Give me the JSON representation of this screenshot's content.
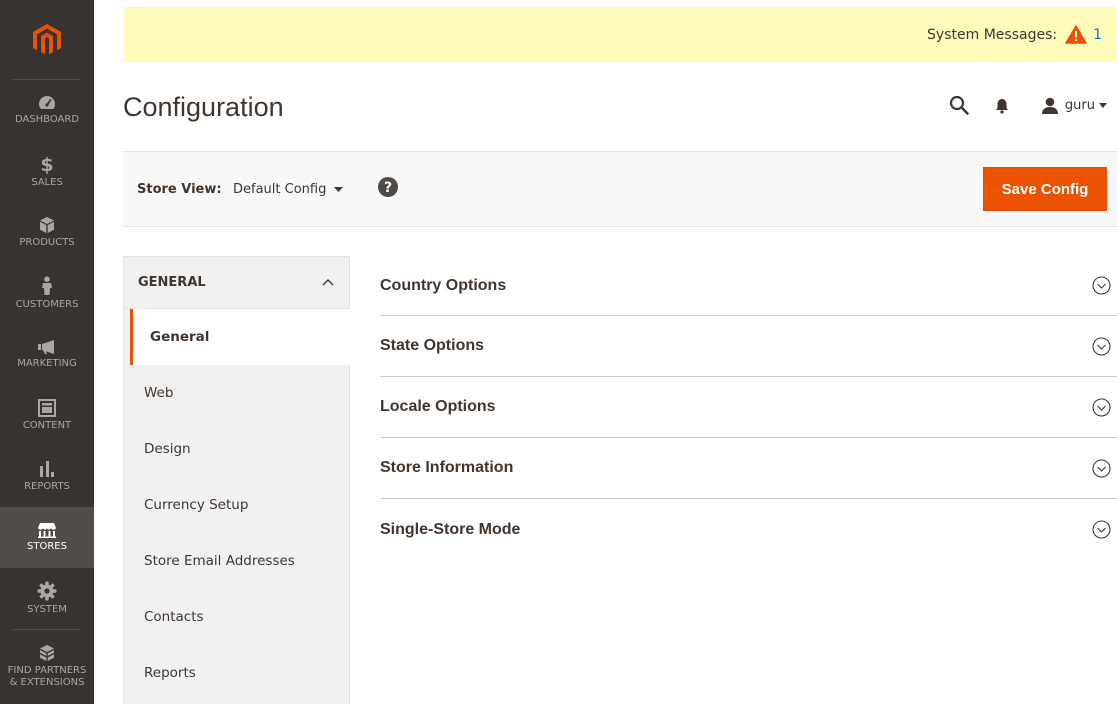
{
  "menu": {
    "items": [
      {
        "label": "DASHBOARD"
      },
      {
        "label": "SALES"
      },
      {
        "label": "PRODUCTS"
      },
      {
        "label": "CUSTOMERS"
      },
      {
        "label": "MARKETING"
      },
      {
        "label": "CONTENT"
      },
      {
        "label": "REPORTS"
      },
      {
        "label": "STORES"
      },
      {
        "label": "SYSTEM"
      },
      {
        "label": "FIND PARTNERS & EXTENSIONS"
      }
    ],
    "active": "STORES"
  },
  "notifications": {
    "label": "System Messages:",
    "count": "1"
  },
  "header": {
    "title": "Configuration",
    "user": "guru"
  },
  "store_switcher": {
    "label": "Store View:",
    "selected": "Default Config",
    "save_label": "Save Config"
  },
  "config_nav": {
    "section_title": "GENERAL",
    "items": [
      {
        "label": "General"
      },
      {
        "label": "Web"
      },
      {
        "label": "Design"
      },
      {
        "label": "Currency Setup"
      },
      {
        "label": "Store Email Addresses"
      },
      {
        "label": "Contacts"
      },
      {
        "label": "Reports"
      }
    ],
    "active": "General"
  },
  "sections": [
    {
      "title": "Country Options"
    },
    {
      "title": "State Options"
    },
    {
      "title": "Locale Options"
    },
    {
      "title": "Store Information"
    },
    {
      "title": "Single-Store Mode"
    }
  ],
  "colors": {
    "menu_bg": "#373330",
    "menu_active_bg": "#524d49",
    "accent": "#eb5202",
    "notice_bg": "#fffbbb",
    "warning": "#eb5202",
    "link": "#007bdb"
  },
  "icons": {
    "logo": "magento-logo",
    "dashboard": "speedometer-icon",
    "sales": "dollar-icon",
    "products": "cube-icon",
    "customers": "person-icon",
    "marketing": "megaphone-icon",
    "content": "layout-icon",
    "reports": "bar-chart-icon",
    "stores": "storefront-icon",
    "system": "gear-icon",
    "partners": "boxes-icon"
  }
}
